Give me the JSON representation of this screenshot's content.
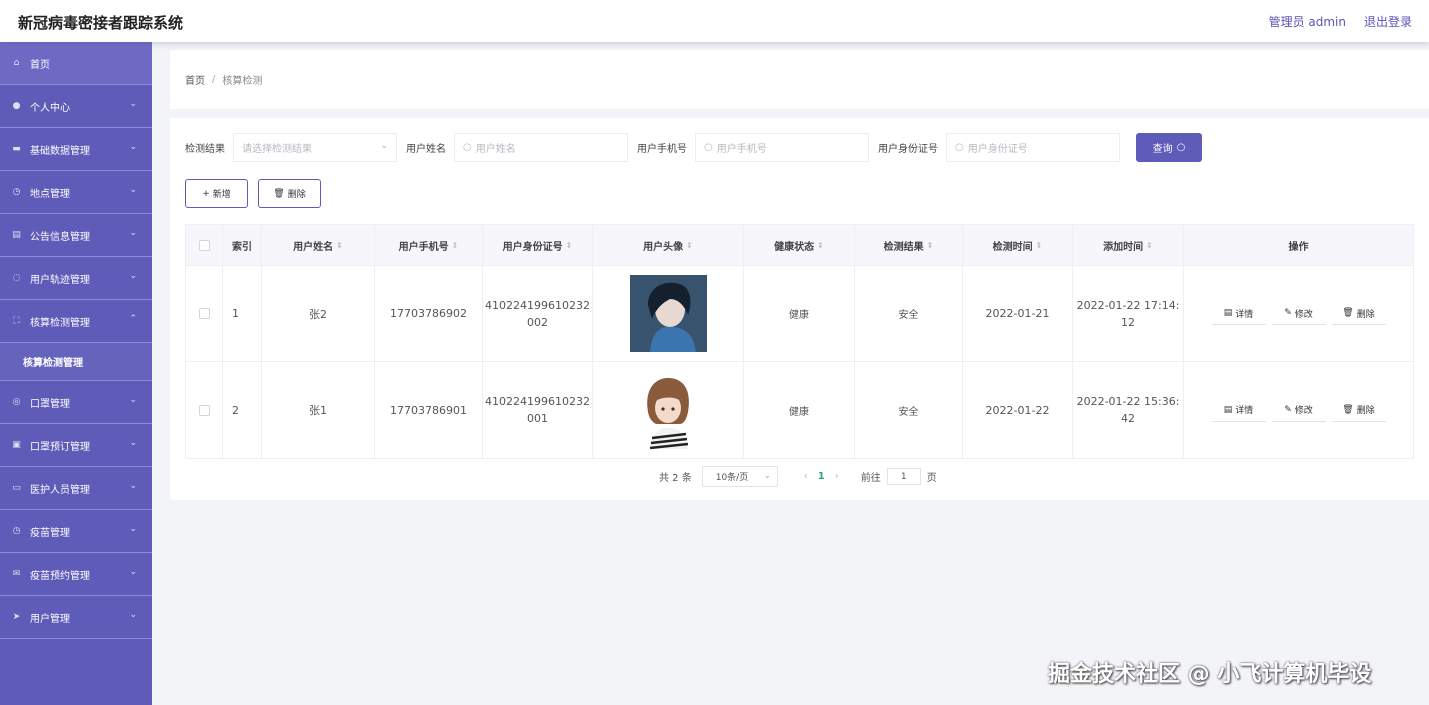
{
  "app": {
    "title": "新冠病毒密接者跟踪系统",
    "admin_label": "管理员 admin",
    "logout": "退出登录"
  },
  "sidebar": {
    "items": [
      {
        "label": "首页",
        "icon": "home-icon"
      },
      {
        "label": "个人中心",
        "icon": "user-icon"
      },
      {
        "label": "基础数据管理",
        "icon": "card-icon"
      },
      {
        "label": "地点管理",
        "icon": "clock-icon"
      },
      {
        "label": "公告信息管理",
        "icon": "doc-icon"
      },
      {
        "label": "用户轨迹管理",
        "icon": "route-icon"
      },
      {
        "label": "核算检测管理",
        "icon": "scan-icon"
      },
      {
        "label": "口罩管理",
        "icon": "circle-icon"
      },
      {
        "label": "口罩预订管理",
        "icon": "box-icon"
      },
      {
        "label": "医护人员管理",
        "icon": "chat-icon"
      },
      {
        "label": "疫苗管理",
        "icon": "clock-icon"
      },
      {
        "label": "疫苗预约管理",
        "icon": "mail-icon"
      },
      {
        "label": "用户管理",
        "icon": "send-icon"
      }
    ],
    "sub_active": "核算检测管理"
  },
  "breadcrumb": {
    "home": "首页",
    "sep": "/",
    "current": "核算检测"
  },
  "filters": {
    "result_label": "检测结果",
    "result_placeholder": "请选择检测结果",
    "name_label": "用户姓名",
    "name_placeholder": "用户姓名",
    "phone_label": "用户手机号",
    "phone_placeholder": "用户手机号",
    "id_label": "用户身份证号",
    "id_placeholder": "用户身份证号",
    "query": "查询"
  },
  "actions": {
    "add": "新增",
    "delete": "删除"
  },
  "table": {
    "headers": [
      "索引",
      "用户姓名",
      "用户手机号",
      "用户身份证号",
      "用户头像",
      "健康状态",
      "检测结果",
      "检测时间",
      "添加时间",
      "操作"
    ],
    "rows": [
      {
        "index": "1",
        "name": "张2",
        "phone": "17703786902",
        "id_line1": "410224199610232",
        "id_line2": "002",
        "health": "健康",
        "result": "安全",
        "test_time": "2022-01-21",
        "add_line1": "2022-01-22 17:14:",
        "add_line2": "12"
      },
      {
        "index": "2",
        "name": "张1",
        "phone": "17703786901",
        "id_line1": "410224199610232",
        "id_line2": "001",
        "health": "健康",
        "result": "安全",
        "test_time": "2022-01-22",
        "add_line1": "2022-01-22 15:36:",
        "add_line2": "42"
      }
    ],
    "ops": {
      "detail": "详情",
      "edit": "修改",
      "delete": "删除"
    }
  },
  "pager": {
    "total": "共 2 条",
    "size": "10条/页",
    "current": "1",
    "goto": "前往",
    "goto_value": "1",
    "page": "页"
  },
  "watermark": "掘金技术社区 @ 小飞计算机毕设"
}
